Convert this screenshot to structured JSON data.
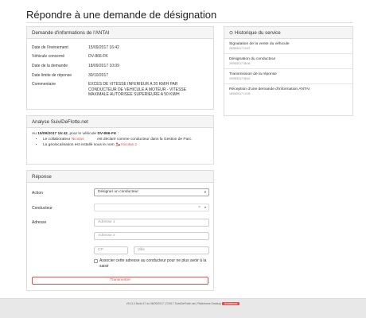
{
  "page": {
    "title": "Répondre à une demande de désignation"
  },
  "antai": {
    "heading": "Demande d'informations de l'ANTAI",
    "rows": [
      {
        "label": "Date de l'événement",
        "value": "15/09/2017 16:42"
      },
      {
        "label": "Véhicule concerné",
        "value": "DV-866-FK"
      },
      {
        "label": "Date de la demande",
        "value": "18/09/2017 10:09"
      },
      {
        "label": "Date limite de réponse",
        "value": "30/10/2017"
      },
      {
        "label": "Commentaire",
        "value": "EXCES DE VITESSE INFERIEUR A 20 KM/H PAR CONDUCTEUR DE VEHICULE A MOTEUR - VITESSE MAXIMALE AUTORISEE SUPERIEURE A 50 KM/H"
      }
    ]
  },
  "history": {
    "heading": "Historique du service",
    "items": [
      {
        "label": "Signalation de la vente du véhicule",
        "date": "29/09/2017 19:57"
      },
      {
        "label": "Désignation du conducteur",
        "date": "29/09/2017 08:06"
      },
      {
        "label": "Transmission de la réponse",
        "date": "19/09/2017 08:42"
      },
      {
        "label": "Réception d'une demande d'information ANTAI",
        "date": "18/09/2017 10:09"
      }
    ]
  },
  "suivi": {
    "heading": "Analyse SuiviDeFlotte.net",
    "intro_prefix": "Au",
    "intro_date": "15/09/2017 16:42",
    "intro_middle": ", pour le véhicule",
    "intro_vehicle": "DV-866-FK",
    "intro_suffix": ":",
    "bullet1_prefix": "Le collaborateur",
    "bullet1_name": "Nicolas",
    "bullet1_suffix": "est déclaré comme conducteur dans la Gestion de Parc.",
    "bullet2_prefix": "La géolocalisation est installé sous le nom",
    "bullet2_name": "Nicolas 2"
  },
  "response": {
    "heading": "Réponse",
    "action_label": "Action",
    "action_value": "Désigner un conducteur",
    "conducteur_label": "Conducteur",
    "adresse_label": "Adresse",
    "address1_placeholder": "Adresse 1",
    "address2_placeholder": "Adresse 2",
    "cp_placeholder": "CP",
    "ville_placeholder": "Ville",
    "checkbox_label": "Associer cette adresse au conducteur pour ne plus avoir à la saisir",
    "submit_label": "Transmettre"
  },
  "footer": {
    "text": "V5.11.0 Build 47 du 08/09/2017 | ©2017 SuiviDeFlotte.net | Plateforme Desktop",
    "badge": "Assistance"
  },
  "colors": {
    "accent": "#d9534f"
  }
}
